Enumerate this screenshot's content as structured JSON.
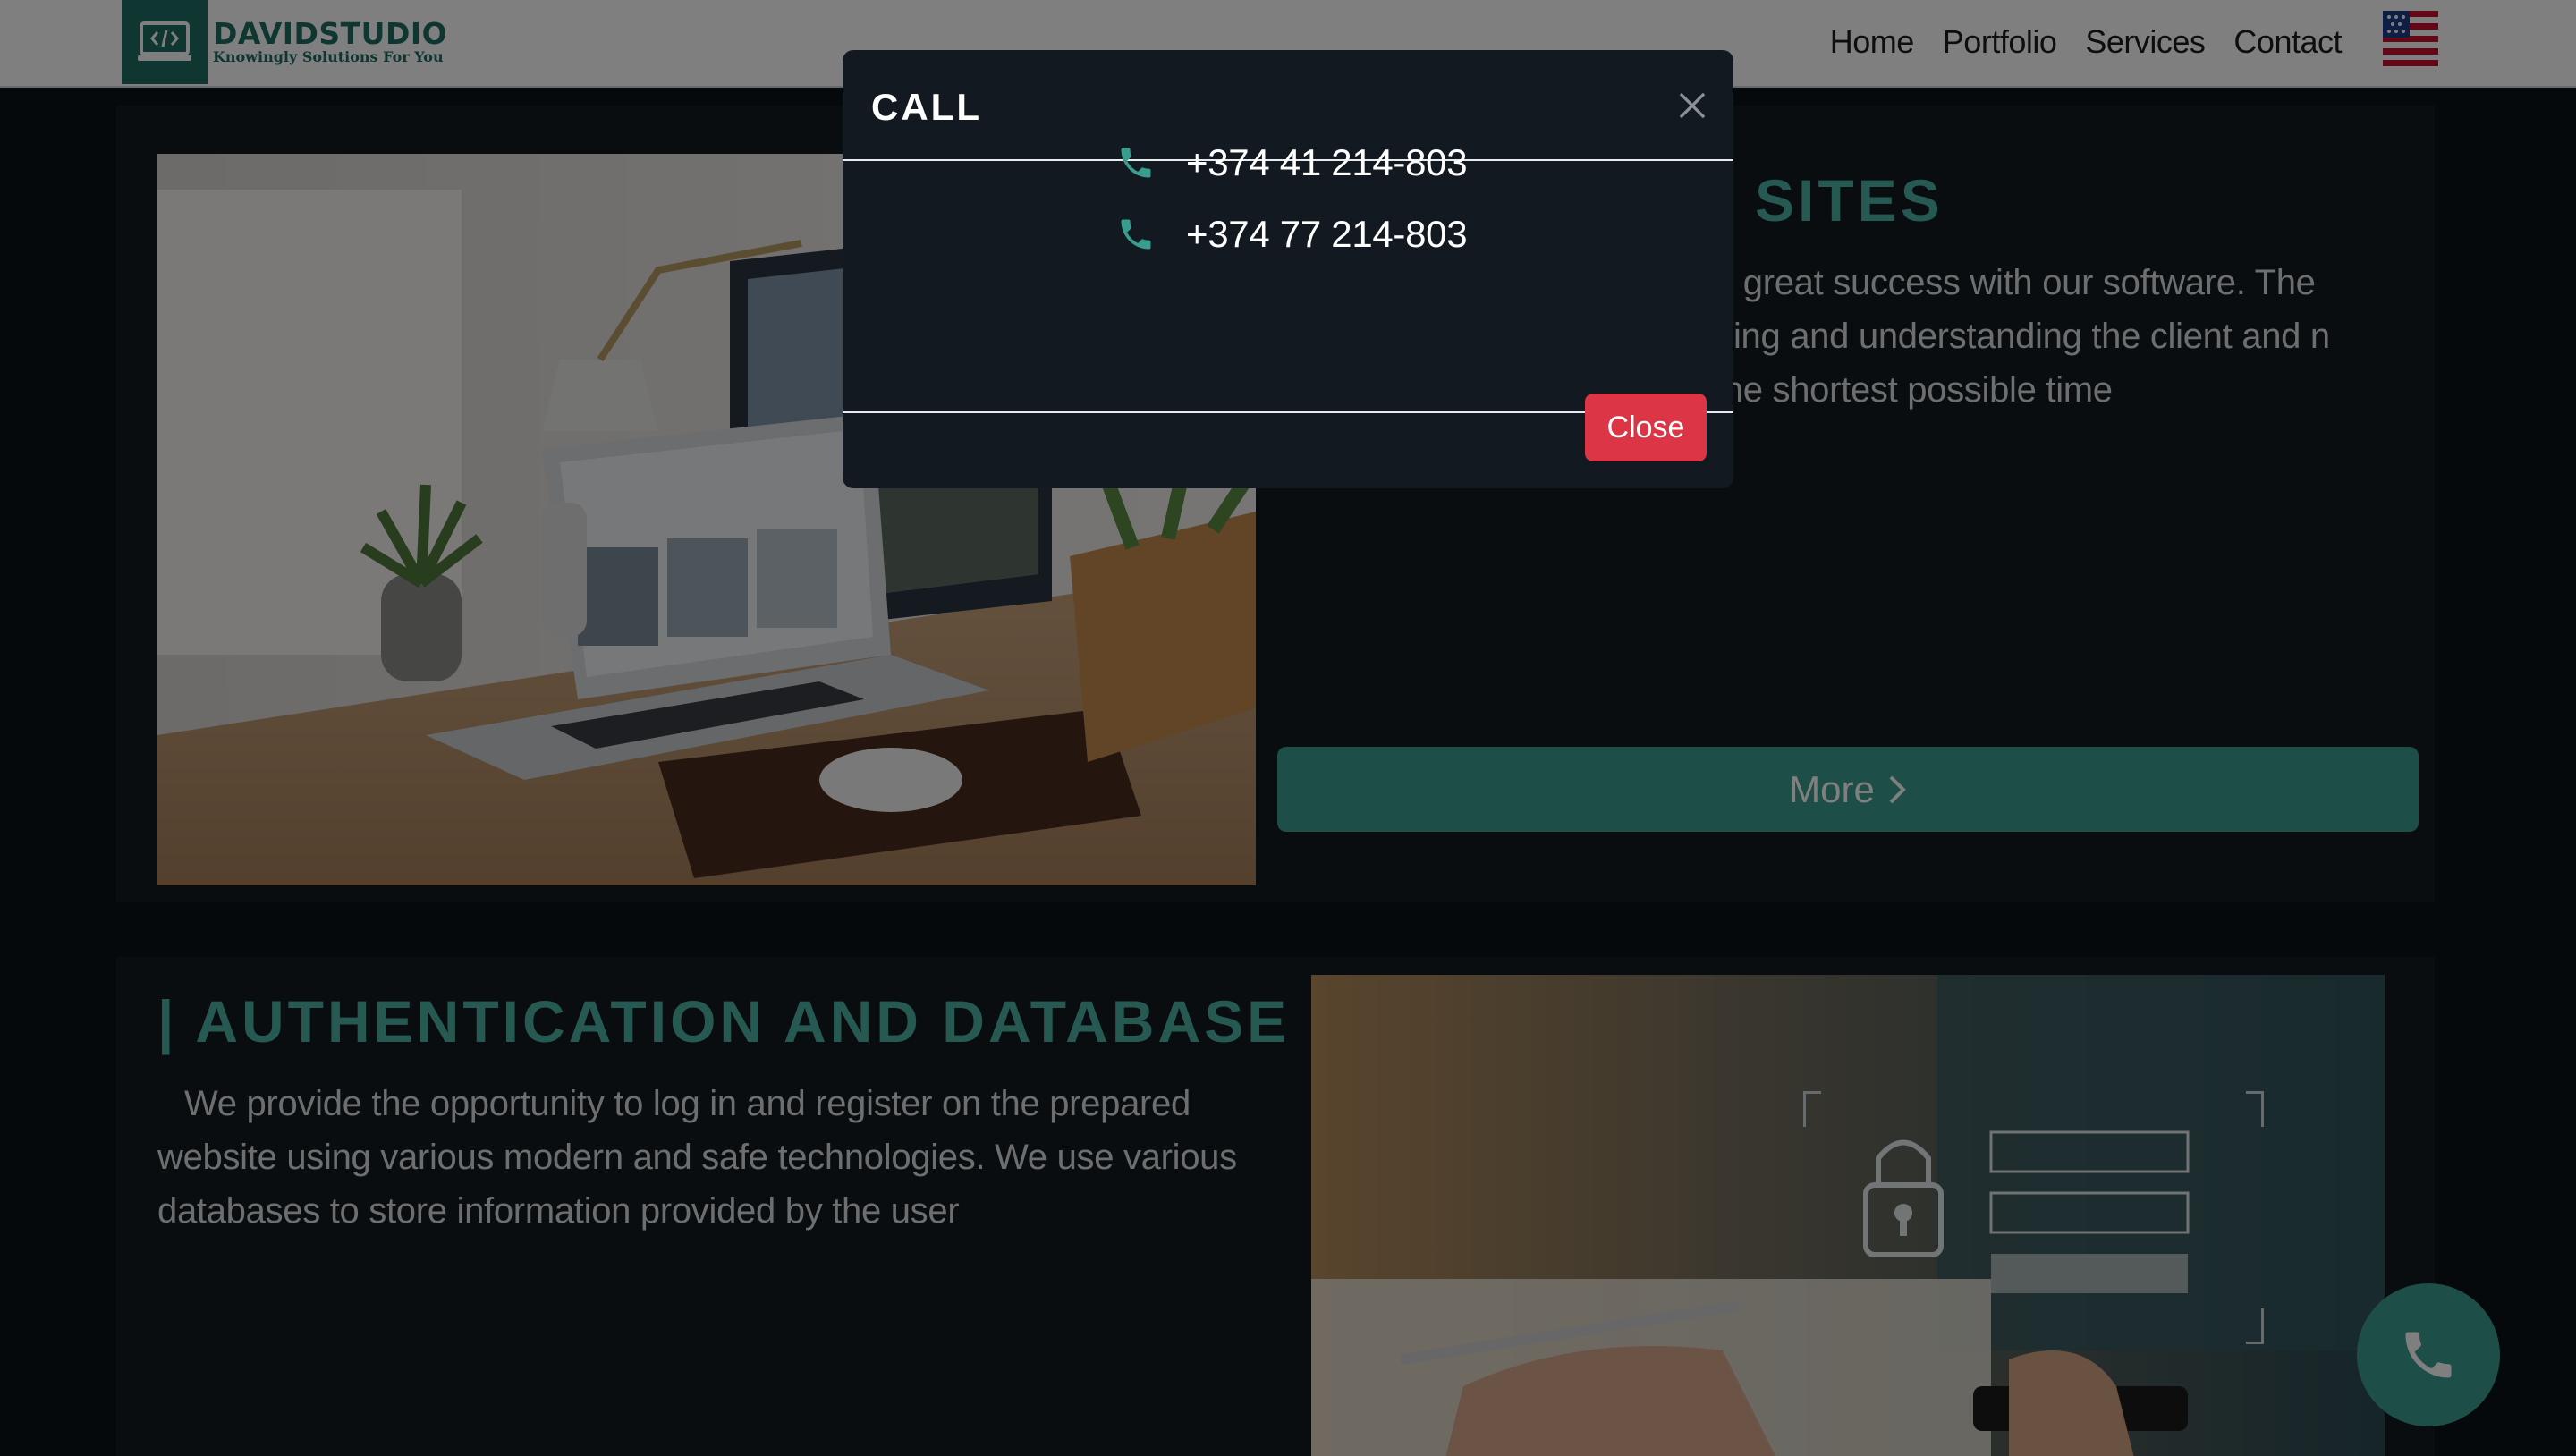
{
  "header": {
    "logo_name": "DAVIDSTUDIO",
    "logo_tagline": "Knowingly Solutions For You",
    "nav": [
      "Home",
      "Portfolio",
      "Services",
      "Contact"
    ],
    "language_flag": "us-flag-icon"
  },
  "section1": {
    "title_visible": "B SITES",
    "body_visible": "e great success with our software. The ning and understanding the client and n the shortest possible time",
    "more_label": "More"
  },
  "section2": {
    "title": "| AUTHENTICATION AND DATABASE",
    "body": "We provide the opportunity to log in and register on the prepared website using various modern and safe technologies. We use various databases to store information provided by the user"
  },
  "modal": {
    "title": "CALL",
    "phones": [
      "+374 41 214-803",
      "+374 77 214-803"
    ],
    "close_label": "Close"
  },
  "colors": {
    "accent": "#3a9c8e",
    "danger": "#dc3545",
    "modal_bg": "#121920"
  }
}
